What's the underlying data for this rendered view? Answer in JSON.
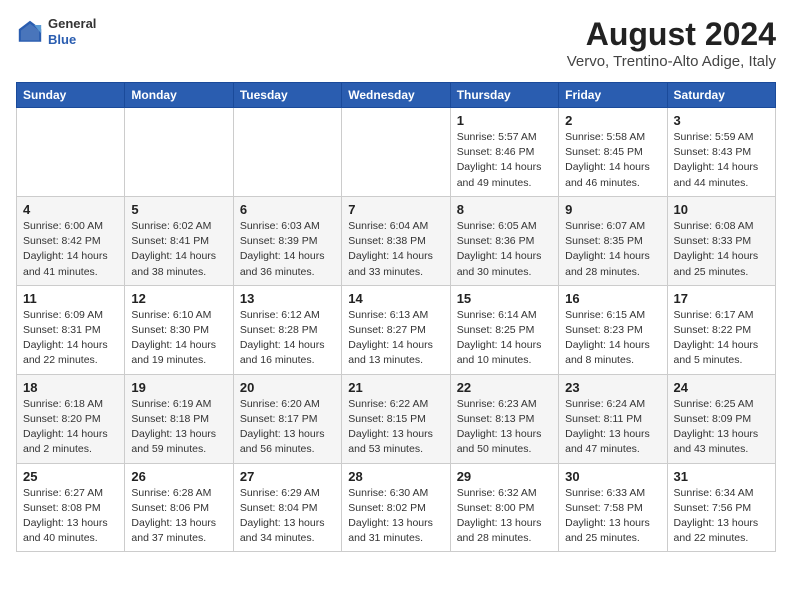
{
  "header": {
    "logo": {
      "general": "General",
      "blue": "Blue"
    },
    "title": "August 2024",
    "subtitle": "Vervo, Trentino-Alto Adige, Italy"
  },
  "calendar": {
    "weekdays": [
      "Sunday",
      "Monday",
      "Tuesday",
      "Wednesday",
      "Thursday",
      "Friday",
      "Saturday"
    ],
    "weeks": [
      [
        {
          "day": "",
          "info": ""
        },
        {
          "day": "",
          "info": ""
        },
        {
          "day": "",
          "info": ""
        },
        {
          "day": "",
          "info": ""
        },
        {
          "day": "1",
          "info": "Sunrise: 5:57 AM\nSunset: 8:46 PM\nDaylight: 14 hours and 49 minutes."
        },
        {
          "day": "2",
          "info": "Sunrise: 5:58 AM\nSunset: 8:45 PM\nDaylight: 14 hours and 46 minutes."
        },
        {
          "day": "3",
          "info": "Sunrise: 5:59 AM\nSunset: 8:43 PM\nDaylight: 14 hours and 44 minutes."
        }
      ],
      [
        {
          "day": "4",
          "info": "Sunrise: 6:00 AM\nSunset: 8:42 PM\nDaylight: 14 hours and 41 minutes."
        },
        {
          "day": "5",
          "info": "Sunrise: 6:02 AM\nSunset: 8:41 PM\nDaylight: 14 hours and 38 minutes."
        },
        {
          "day": "6",
          "info": "Sunrise: 6:03 AM\nSunset: 8:39 PM\nDaylight: 14 hours and 36 minutes."
        },
        {
          "day": "7",
          "info": "Sunrise: 6:04 AM\nSunset: 8:38 PM\nDaylight: 14 hours and 33 minutes."
        },
        {
          "day": "8",
          "info": "Sunrise: 6:05 AM\nSunset: 8:36 PM\nDaylight: 14 hours and 30 minutes."
        },
        {
          "day": "9",
          "info": "Sunrise: 6:07 AM\nSunset: 8:35 PM\nDaylight: 14 hours and 28 minutes."
        },
        {
          "day": "10",
          "info": "Sunrise: 6:08 AM\nSunset: 8:33 PM\nDaylight: 14 hours and 25 minutes."
        }
      ],
      [
        {
          "day": "11",
          "info": "Sunrise: 6:09 AM\nSunset: 8:31 PM\nDaylight: 14 hours and 22 minutes."
        },
        {
          "day": "12",
          "info": "Sunrise: 6:10 AM\nSunset: 8:30 PM\nDaylight: 14 hours and 19 minutes."
        },
        {
          "day": "13",
          "info": "Sunrise: 6:12 AM\nSunset: 8:28 PM\nDaylight: 14 hours and 16 minutes."
        },
        {
          "day": "14",
          "info": "Sunrise: 6:13 AM\nSunset: 8:27 PM\nDaylight: 14 hours and 13 minutes."
        },
        {
          "day": "15",
          "info": "Sunrise: 6:14 AM\nSunset: 8:25 PM\nDaylight: 14 hours and 10 minutes."
        },
        {
          "day": "16",
          "info": "Sunrise: 6:15 AM\nSunset: 8:23 PM\nDaylight: 14 hours and 8 minutes."
        },
        {
          "day": "17",
          "info": "Sunrise: 6:17 AM\nSunset: 8:22 PM\nDaylight: 14 hours and 5 minutes."
        }
      ],
      [
        {
          "day": "18",
          "info": "Sunrise: 6:18 AM\nSunset: 8:20 PM\nDaylight: 14 hours and 2 minutes."
        },
        {
          "day": "19",
          "info": "Sunrise: 6:19 AM\nSunset: 8:18 PM\nDaylight: 13 hours and 59 minutes."
        },
        {
          "day": "20",
          "info": "Sunrise: 6:20 AM\nSunset: 8:17 PM\nDaylight: 13 hours and 56 minutes."
        },
        {
          "day": "21",
          "info": "Sunrise: 6:22 AM\nSunset: 8:15 PM\nDaylight: 13 hours and 53 minutes."
        },
        {
          "day": "22",
          "info": "Sunrise: 6:23 AM\nSunset: 8:13 PM\nDaylight: 13 hours and 50 minutes."
        },
        {
          "day": "23",
          "info": "Sunrise: 6:24 AM\nSunset: 8:11 PM\nDaylight: 13 hours and 47 minutes."
        },
        {
          "day": "24",
          "info": "Sunrise: 6:25 AM\nSunset: 8:09 PM\nDaylight: 13 hours and 43 minutes."
        }
      ],
      [
        {
          "day": "25",
          "info": "Sunrise: 6:27 AM\nSunset: 8:08 PM\nDaylight: 13 hours and 40 minutes."
        },
        {
          "day": "26",
          "info": "Sunrise: 6:28 AM\nSunset: 8:06 PM\nDaylight: 13 hours and 37 minutes."
        },
        {
          "day": "27",
          "info": "Sunrise: 6:29 AM\nSunset: 8:04 PM\nDaylight: 13 hours and 34 minutes."
        },
        {
          "day": "28",
          "info": "Sunrise: 6:30 AM\nSunset: 8:02 PM\nDaylight: 13 hours and 31 minutes."
        },
        {
          "day": "29",
          "info": "Sunrise: 6:32 AM\nSunset: 8:00 PM\nDaylight: 13 hours and 28 minutes."
        },
        {
          "day": "30",
          "info": "Sunrise: 6:33 AM\nSunset: 7:58 PM\nDaylight: 13 hours and 25 minutes."
        },
        {
          "day": "31",
          "info": "Sunrise: 6:34 AM\nSunset: 7:56 PM\nDaylight: 13 hours and 22 minutes."
        }
      ]
    ]
  }
}
